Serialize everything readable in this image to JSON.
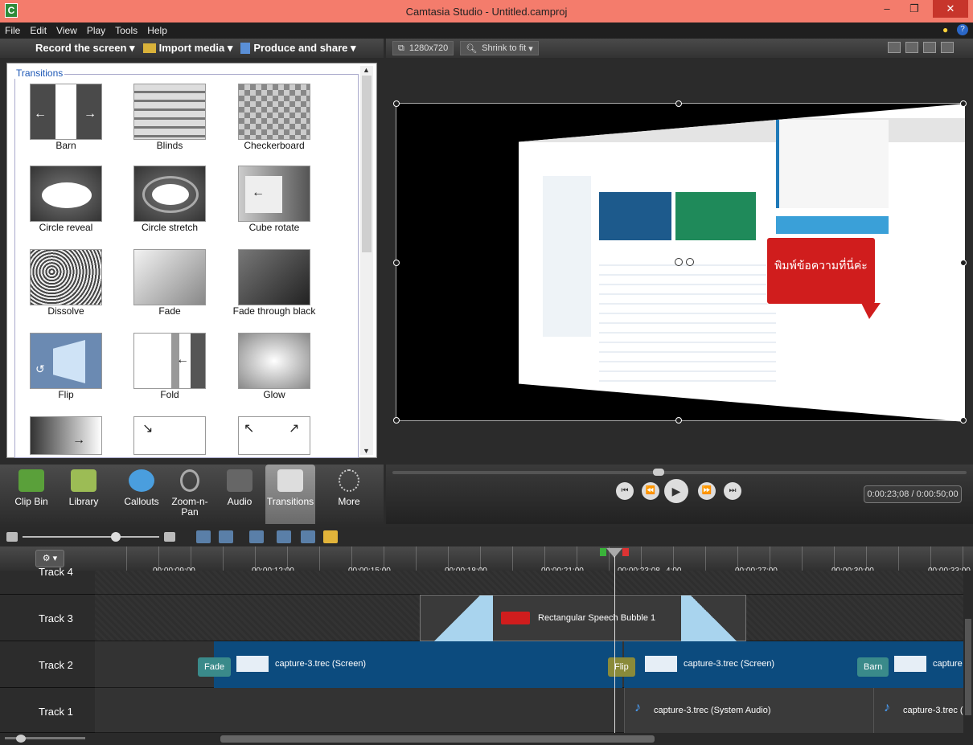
{
  "window": {
    "title": "Camtasia Studio - Untitled.camproj",
    "logo": "C"
  },
  "menu": [
    "File",
    "Edit",
    "View",
    "Play",
    "Tools",
    "Help"
  ],
  "toolbar": {
    "record": "Record the screen ▾",
    "import": "Import media ▾",
    "produce": "Produce and share ▾"
  },
  "preview_toolbar": {
    "size": "1280x720",
    "zoom": "Shrink to fit"
  },
  "transitions": {
    "legend": "Transitions",
    "items": [
      {
        "label": "Barn"
      },
      {
        "label": "Blinds"
      },
      {
        "label": "Checkerboard"
      },
      {
        "label": "Circle reveal"
      },
      {
        "label": "Circle stretch"
      },
      {
        "label": "Cube rotate"
      },
      {
        "label": "Dissolve"
      },
      {
        "label": "Fade"
      },
      {
        "label": "Fade through black"
      },
      {
        "label": "Flip"
      },
      {
        "label": "Fold"
      },
      {
        "label": "Glow"
      }
    ]
  },
  "tabs": [
    {
      "label": "Clip Bin"
    },
    {
      "label": "Library"
    },
    {
      "label": "Callouts"
    },
    {
      "label": "Zoom-n-Pan"
    },
    {
      "label": "Audio"
    },
    {
      "label": "Transitions"
    },
    {
      "label": "More"
    }
  ],
  "player": {
    "time": "0:00:23;08 / 0:00:50;00"
  },
  "callout_text": "พิมพ์ข้อความที่นี่ค่ะ",
  "timeline": {
    "ticks": [
      "00:00:09;00",
      "00:00:12;00",
      "00:00:15;00",
      "00:00:18;00",
      "00:00:21;00",
      "00:00:23;08",
      "4;00",
      "00:00:27;00",
      "00:00:30;00",
      "00:00:33;00"
    ],
    "tracks": [
      {
        "name": "Track 4"
      },
      {
        "name": "Track 3"
      },
      {
        "name": "Track 2"
      },
      {
        "name": "Track 1"
      }
    ],
    "callout_clip": "Rectangular Speech Bubble 1",
    "screen_clip_1": "capture-3.trec (Screen)",
    "screen_clip_2": "capture-3.trec (Screen)",
    "screen_clip_3": "capture",
    "audio_clip_1": "capture-3.trec (System Audio)",
    "audio_clip_2": "capture-3.trec (",
    "badges": {
      "fade": "Fade",
      "flip": "Flip",
      "barn": "Barn"
    }
  }
}
